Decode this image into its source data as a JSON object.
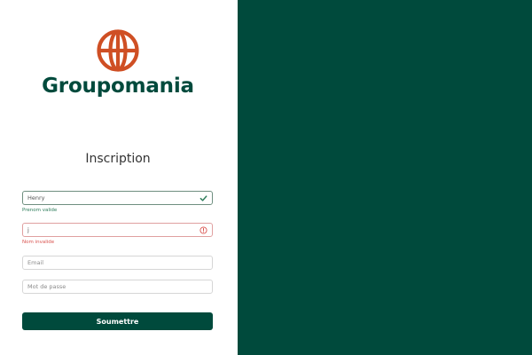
{
  "brand": {
    "name": "Groupomania",
    "logo_icon": "globe-logo-icon",
    "logo_color": "#cf4f24",
    "brand_color": "#004a3c"
  },
  "form": {
    "title": "Inscription",
    "fields": {
      "firstname": {
        "value": "Henry",
        "feedback": "Prenom valide",
        "status": "valid",
        "icon": "check-icon"
      },
      "lastname": {
        "value": "j",
        "feedback": "Nom invalide",
        "status": "invalid",
        "icon": "alert-circle-icon"
      },
      "email": {
        "placeholder": "Email"
      },
      "password": {
        "placeholder": "Mot de passe"
      }
    },
    "submit_label": "Soumettre"
  },
  "colors": {
    "primary": "#004a3c",
    "valid": "#2e7d5b",
    "invalid": "#d9534f",
    "right_panel": "#004a3c"
  }
}
